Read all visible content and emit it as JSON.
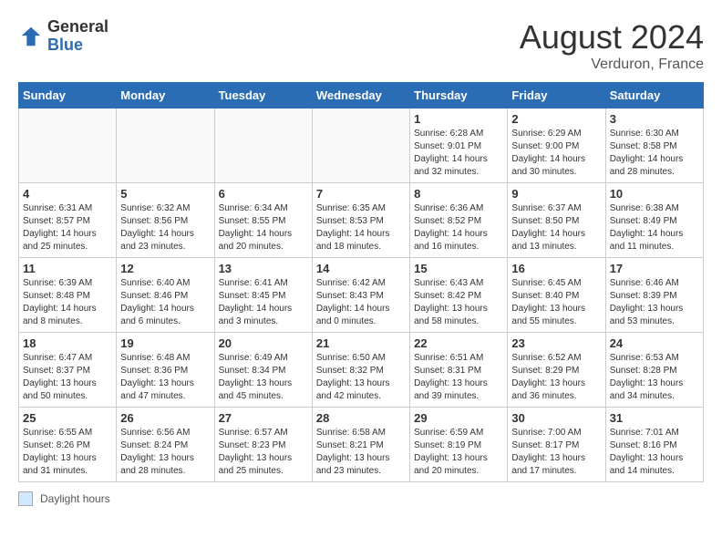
{
  "header": {
    "logo_general": "General",
    "logo_blue": "Blue",
    "month_year": "August 2024",
    "location": "Verduron, France"
  },
  "footer": {
    "label": "Daylight hours"
  },
  "weekdays": [
    "Sunday",
    "Monday",
    "Tuesday",
    "Wednesday",
    "Thursday",
    "Friday",
    "Saturday"
  ],
  "weeks": [
    [
      {
        "day": "",
        "empty": true
      },
      {
        "day": "",
        "empty": true
      },
      {
        "day": "",
        "empty": true
      },
      {
        "day": "",
        "empty": true
      },
      {
        "day": "1",
        "sunrise": "Sunrise: 6:28 AM",
        "sunset": "Sunset: 9:01 PM",
        "daylight": "Daylight: 14 hours and 32 minutes."
      },
      {
        "day": "2",
        "sunrise": "Sunrise: 6:29 AM",
        "sunset": "Sunset: 9:00 PM",
        "daylight": "Daylight: 14 hours and 30 minutes."
      },
      {
        "day": "3",
        "sunrise": "Sunrise: 6:30 AM",
        "sunset": "Sunset: 8:58 PM",
        "daylight": "Daylight: 14 hours and 28 minutes."
      }
    ],
    [
      {
        "day": "4",
        "sunrise": "Sunrise: 6:31 AM",
        "sunset": "Sunset: 8:57 PM",
        "daylight": "Daylight: 14 hours and 25 minutes."
      },
      {
        "day": "5",
        "sunrise": "Sunrise: 6:32 AM",
        "sunset": "Sunset: 8:56 PM",
        "daylight": "Daylight: 14 hours and 23 minutes."
      },
      {
        "day": "6",
        "sunrise": "Sunrise: 6:34 AM",
        "sunset": "Sunset: 8:55 PM",
        "daylight": "Daylight: 14 hours and 20 minutes."
      },
      {
        "day": "7",
        "sunrise": "Sunrise: 6:35 AM",
        "sunset": "Sunset: 8:53 PM",
        "daylight": "Daylight: 14 hours and 18 minutes."
      },
      {
        "day": "8",
        "sunrise": "Sunrise: 6:36 AM",
        "sunset": "Sunset: 8:52 PM",
        "daylight": "Daylight: 14 hours and 16 minutes."
      },
      {
        "day": "9",
        "sunrise": "Sunrise: 6:37 AM",
        "sunset": "Sunset: 8:50 PM",
        "daylight": "Daylight: 14 hours and 13 minutes."
      },
      {
        "day": "10",
        "sunrise": "Sunrise: 6:38 AM",
        "sunset": "Sunset: 8:49 PM",
        "daylight": "Daylight: 14 hours and 11 minutes."
      }
    ],
    [
      {
        "day": "11",
        "sunrise": "Sunrise: 6:39 AM",
        "sunset": "Sunset: 8:48 PM",
        "daylight": "Daylight: 14 hours and 8 minutes."
      },
      {
        "day": "12",
        "sunrise": "Sunrise: 6:40 AM",
        "sunset": "Sunset: 8:46 PM",
        "daylight": "Daylight: 14 hours and 6 minutes."
      },
      {
        "day": "13",
        "sunrise": "Sunrise: 6:41 AM",
        "sunset": "Sunset: 8:45 PM",
        "daylight": "Daylight: 14 hours and 3 minutes."
      },
      {
        "day": "14",
        "sunrise": "Sunrise: 6:42 AM",
        "sunset": "Sunset: 8:43 PM",
        "daylight": "Daylight: 14 hours and 0 minutes."
      },
      {
        "day": "15",
        "sunrise": "Sunrise: 6:43 AM",
        "sunset": "Sunset: 8:42 PM",
        "daylight": "Daylight: 13 hours and 58 minutes."
      },
      {
        "day": "16",
        "sunrise": "Sunrise: 6:45 AM",
        "sunset": "Sunset: 8:40 PM",
        "daylight": "Daylight: 13 hours and 55 minutes."
      },
      {
        "day": "17",
        "sunrise": "Sunrise: 6:46 AM",
        "sunset": "Sunset: 8:39 PM",
        "daylight": "Daylight: 13 hours and 53 minutes."
      }
    ],
    [
      {
        "day": "18",
        "sunrise": "Sunrise: 6:47 AM",
        "sunset": "Sunset: 8:37 PM",
        "daylight": "Daylight: 13 hours and 50 minutes."
      },
      {
        "day": "19",
        "sunrise": "Sunrise: 6:48 AM",
        "sunset": "Sunset: 8:36 PM",
        "daylight": "Daylight: 13 hours and 47 minutes."
      },
      {
        "day": "20",
        "sunrise": "Sunrise: 6:49 AM",
        "sunset": "Sunset: 8:34 PM",
        "daylight": "Daylight: 13 hours and 45 minutes."
      },
      {
        "day": "21",
        "sunrise": "Sunrise: 6:50 AM",
        "sunset": "Sunset: 8:32 PM",
        "daylight": "Daylight: 13 hours and 42 minutes."
      },
      {
        "day": "22",
        "sunrise": "Sunrise: 6:51 AM",
        "sunset": "Sunset: 8:31 PM",
        "daylight": "Daylight: 13 hours and 39 minutes."
      },
      {
        "day": "23",
        "sunrise": "Sunrise: 6:52 AM",
        "sunset": "Sunset: 8:29 PM",
        "daylight": "Daylight: 13 hours and 36 minutes."
      },
      {
        "day": "24",
        "sunrise": "Sunrise: 6:53 AM",
        "sunset": "Sunset: 8:28 PM",
        "daylight": "Daylight: 13 hours and 34 minutes."
      }
    ],
    [
      {
        "day": "25",
        "sunrise": "Sunrise: 6:55 AM",
        "sunset": "Sunset: 8:26 PM",
        "daylight": "Daylight: 13 hours and 31 minutes."
      },
      {
        "day": "26",
        "sunrise": "Sunrise: 6:56 AM",
        "sunset": "Sunset: 8:24 PM",
        "daylight": "Daylight: 13 hours and 28 minutes."
      },
      {
        "day": "27",
        "sunrise": "Sunrise: 6:57 AM",
        "sunset": "Sunset: 8:23 PM",
        "daylight": "Daylight: 13 hours and 25 minutes."
      },
      {
        "day": "28",
        "sunrise": "Sunrise: 6:58 AM",
        "sunset": "Sunset: 8:21 PM",
        "daylight": "Daylight: 13 hours and 23 minutes."
      },
      {
        "day": "29",
        "sunrise": "Sunrise: 6:59 AM",
        "sunset": "Sunset: 8:19 PM",
        "daylight": "Daylight: 13 hours and 20 minutes."
      },
      {
        "day": "30",
        "sunrise": "Sunrise: 7:00 AM",
        "sunset": "Sunset: 8:17 PM",
        "daylight": "Daylight: 13 hours and 17 minutes."
      },
      {
        "day": "31",
        "sunrise": "Sunrise: 7:01 AM",
        "sunset": "Sunset: 8:16 PM",
        "daylight": "Daylight: 13 hours and 14 minutes."
      }
    ]
  ]
}
